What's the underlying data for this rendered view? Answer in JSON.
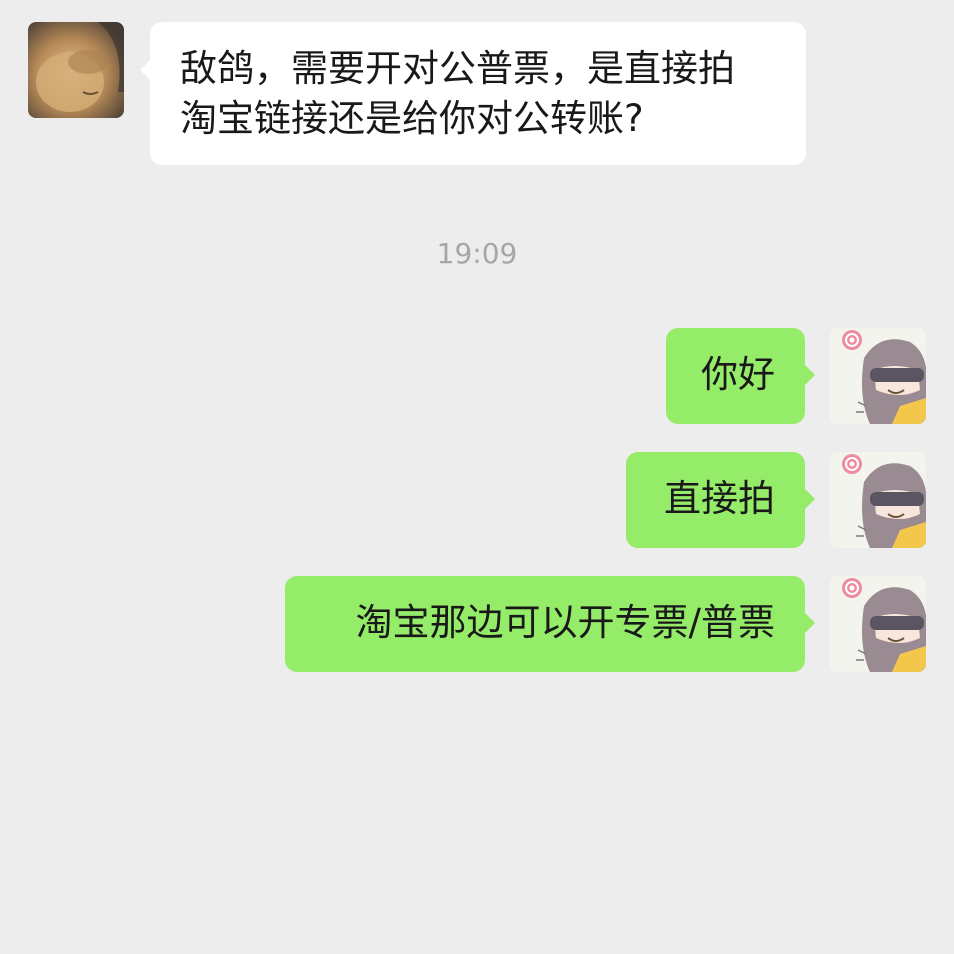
{
  "incoming": {
    "line1": "敌鸽，需要开对公普票，是直接拍",
    "line2": "淘宝链接还是给你对公转账?"
  },
  "timestamp": "19:09",
  "outgoing": [
    {
      "text": "你好"
    },
    {
      "text": "直接拍"
    },
    {
      "text": "淘宝那边可以开专票/普票"
    }
  ],
  "colors": {
    "background": "#ededed",
    "incoming_bubble": "#ffffff",
    "outgoing_bubble": "#95ec69",
    "timestamp_text": "#a6a6a6"
  },
  "icons": {
    "contact_avatar": "avatar-photo",
    "self_avatar": "avatar-cartoon-girl"
  }
}
